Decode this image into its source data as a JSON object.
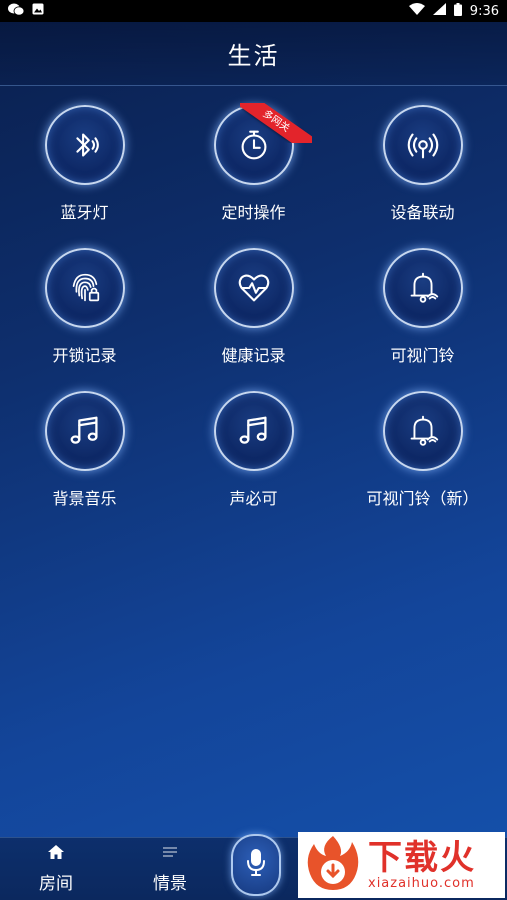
{
  "status_bar": {
    "time": "9:36",
    "left_icons": [
      "wechat-icon",
      "gallery-icon"
    ],
    "right_icons": [
      "wifi-icon",
      "signal-icon",
      "battery-icon"
    ]
  },
  "header": {
    "title": "生活"
  },
  "tiles": [
    {
      "label": "蓝牙灯",
      "icon": "bluetooth-icon"
    },
    {
      "label": "定时操作",
      "icon": "timer-icon",
      "badge": "多网关"
    },
    {
      "label": "设备联动",
      "icon": "linkage-icon"
    },
    {
      "label": "开锁记录",
      "icon": "fingerprint-lock-icon"
    },
    {
      "label": "健康记录",
      "icon": "heart-pulse-icon"
    },
    {
      "label": "可视门铃",
      "icon": "doorbell-icon"
    },
    {
      "label": "背景音乐",
      "icon": "music-note-icon"
    },
    {
      "label": "声必可",
      "icon": "music-note-icon"
    },
    {
      "label": "可视门铃（新）",
      "icon": "doorbell-icon"
    }
  ],
  "bottom_nav": {
    "tabs": [
      {
        "label": "房间",
        "icon": "home-icon"
      },
      {
        "label": "情景",
        "icon": "list-icon"
      }
    ],
    "mic": "microphone-icon"
  },
  "watermark": {
    "main": "下载火",
    "sub": "xiazaihuo.com"
  }
}
